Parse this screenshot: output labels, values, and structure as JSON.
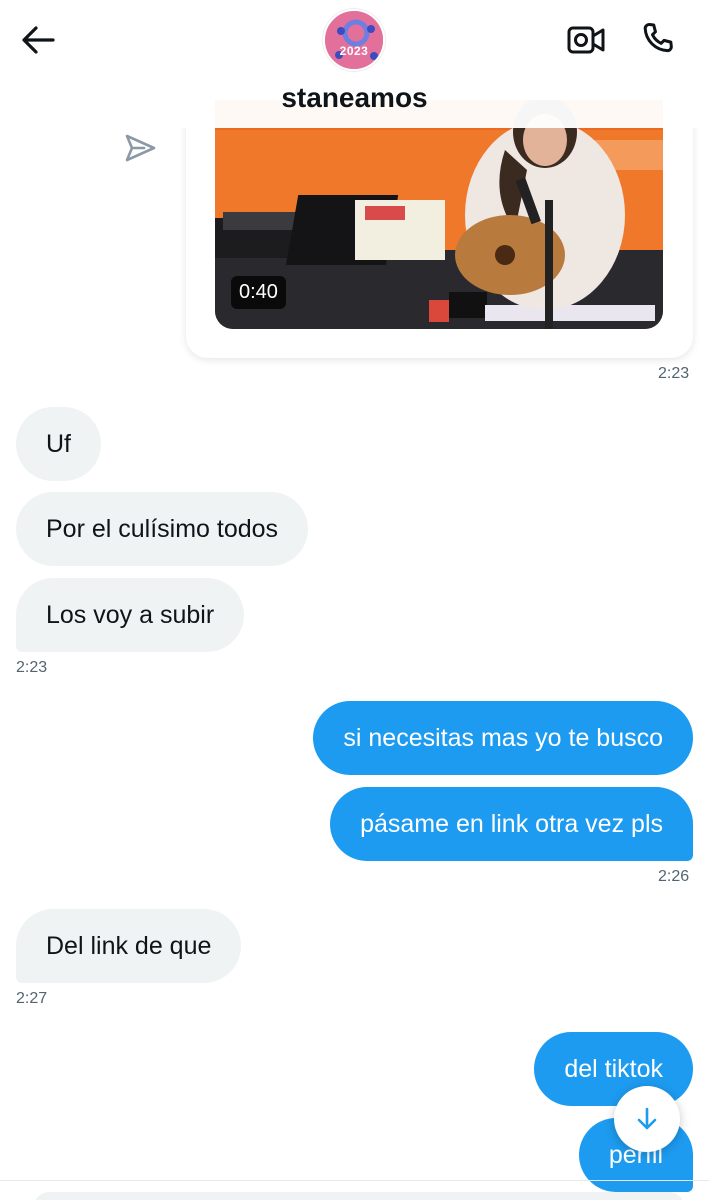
{
  "header": {
    "title": "staneamos",
    "avatar_text": "2023",
    "back_icon": "arrow-left-icon",
    "video_icon": "video-camera-icon",
    "call_icon": "phone-icon"
  },
  "media": {
    "duration": "0:40",
    "time": "2:23"
  },
  "messages": [
    {
      "text": "Uf"
    },
    {
      "text": "Por el culísimo todos"
    },
    {
      "text": "Los voy a subir"
    },
    {
      "text": "si necesitas mas yo te busco"
    },
    {
      "text": "pásame en link otra vez pls"
    },
    {
      "text": "Del link de que"
    },
    {
      "text": "del tiktok"
    },
    {
      "text": "perfil"
    }
  ],
  "timestamps": [
    "2:23",
    "2:26",
    "2:27"
  ],
  "colors": {
    "outgoing": "#1d9bf0",
    "incoming": "#eff3f4",
    "text": "#0f1419"
  }
}
